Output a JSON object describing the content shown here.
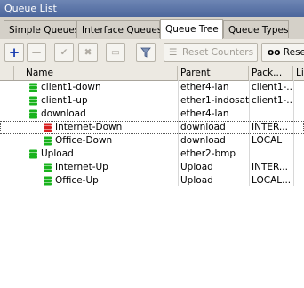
{
  "window": {
    "title": "Queue List"
  },
  "tabs": [
    "Simple Queues",
    "Interface Queues",
    "Queue Tree",
    "Queue Types"
  ],
  "toolbar": {
    "reset_counters": "Reset Counters",
    "oo_label": "oo",
    "reset_all": "Rese"
  },
  "columns": [
    "Name",
    "Parent",
    "Pack...",
    "Li"
  ],
  "rows": [
    {
      "name": "client1-down",
      "parent": "ether4-lan",
      "packet": "client1-...",
      "color": "green"
    },
    {
      "name": "client1-up",
      "parent": "ether1-indosat",
      "packet": "client1-...",
      "color": "green"
    },
    {
      "name": "download",
      "parent": "ether4-lan",
      "packet": "",
      "color": "green"
    },
    {
      "name": "Internet-Down",
      "parent": "download",
      "packet": "INTER...",
      "color": "red"
    },
    {
      "name": "Office-Down",
      "parent": "download",
      "packet": "LOCAL",
      "color": "green"
    },
    {
      "name": "Upload",
      "parent": "ether2-bmp",
      "packet": "",
      "color": "green"
    },
    {
      "name": "Internet-Up",
      "parent": "Upload",
      "packet": "INTER...",
      "color": "green"
    },
    {
      "name": "Office-Up",
      "parent": "Upload",
      "packet": "LOCAL...",
      "color": "green"
    }
  ],
  "colors": {
    "green": "#19b31d",
    "red": "#d81e1e",
    "titlebar": "#5a73a8"
  }
}
